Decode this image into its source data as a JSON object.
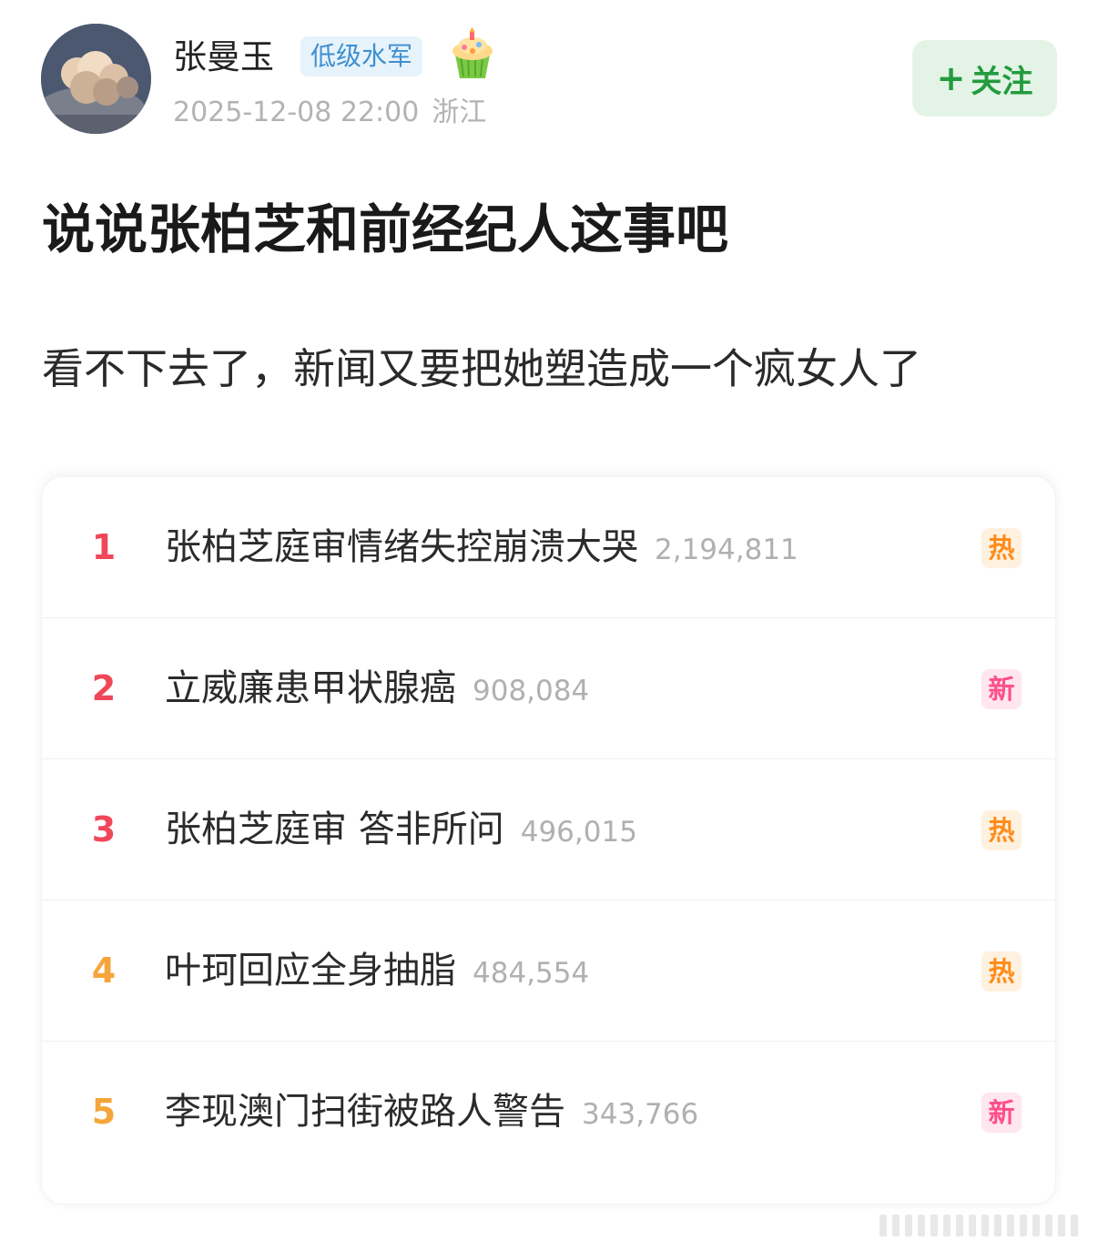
{
  "user": {
    "name": "张曼玉",
    "badge": "低级水军",
    "time": "2025-12-08 22:00",
    "location": "浙江"
  },
  "follow": {
    "plus": "+",
    "label": "关注"
  },
  "post": {
    "title": "说说张柏芝和前经纪人这事吧",
    "body": "看不下去了，新闻又要把她塑造成一个疯女人了"
  },
  "hot_search": [
    {
      "rank": "1",
      "title": "张柏芝庭审情绪失控崩溃大哭",
      "count": "2,194,811",
      "tag": "热",
      "tag_type": "hot",
      "rank_color": "#f0475a"
    },
    {
      "rank": "2",
      "title": "立威廉患甲状腺癌",
      "count": "908,084",
      "tag": "新",
      "tag_type": "new",
      "rank_color": "#f0475a"
    },
    {
      "rank": "3",
      "title": "张柏芝庭审 答非所问",
      "count": "496,015",
      "tag": "热",
      "tag_type": "hot",
      "rank_color": "#f0475a"
    },
    {
      "rank": "4",
      "title": "叶珂回应全身抽脂",
      "count": "484,554",
      "tag": "热",
      "tag_type": "hot",
      "rank_color": "#f5a53a"
    },
    {
      "rank": "5",
      "title": "李现澳门扫街被路人警告",
      "count": "343,766",
      "tag": "新",
      "tag_type": "new",
      "rank_color": "#f5a53a"
    }
  ],
  "icons": {
    "avatar": "cloud-sky-avatar",
    "badge_extra": "cupcake-icon",
    "bottom_right": "menu-icon"
  }
}
